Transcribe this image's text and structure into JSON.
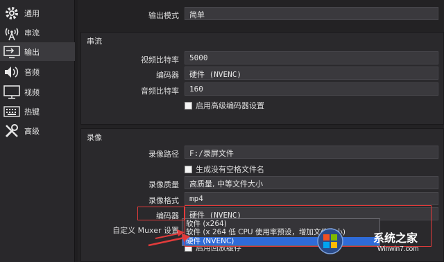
{
  "sidebar": {
    "items": [
      {
        "label": "通用",
        "icon": "gear-icon"
      },
      {
        "label": "串流",
        "icon": "broadcast-antenna-icon"
      },
      {
        "label": "输出",
        "icon": "monitor-output-icon",
        "active": true
      },
      {
        "label": "音频",
        "icon": "speaker-icon"
      },
      {
        "label": "视频",
        "icon": "monitor-icon"
      },
      {
        "label": "热键",
        "icon": "keyboard-icon"
      },
      {
        "label": "高级",
        "icon": "tools-icon"
      }
    ]
  },
  "output_mode": {
    "label": "输出模式",
    "value": "简单"
  },
  "streaming": {
    "title": "串流",
    "video_bitrate": {
      "label": "视频比特率",
      "value": "5000"
    },
    "encoder": {
      "label": "编码器",
      "value": "硬件 (NVENC)"
    },
    "audio_bitrate": {
      "label": "音频比特率",
      "value": "160"
    },
    "advanced_checkbox": "启用高级编码器设置"
  },
  "recording": {
    "title": "录像",
    "path": {
      "label": "录像路径",
      "value": "F:/录屏文件"
    },
    "no_space_checkbox": "生成没有空格文件名",
    "quality": {
      "label": "录像质量",
      "value": "高质量, 中等文件大小"
    },
    "format": {
      "label": "录像格式",
      "value": "mp4"
    },
    "encoder": {
      "label": "编码器",
      "value": "硬件 (NVENC)"
    },
    "muxer": {
      "label": "自定义 Muxer 设置"
    },
    "replay_checkbox": "启用回放缓存",
    "encoder_options": [
      "软件 (x264)",
      "软件 (x 264 低 CPU 使用率预设，增加文件大小)",
      "硬件 (NVENC)"
    ],
    "selected_option_index": 2
  },
  "watermark": {
    "text": "Winwin7.com",
    "brand": "系统之家"
  },
  "colors": {
    "accent": "#2f6bd8",
    "annotation": "#e23b3b"
  }
}
